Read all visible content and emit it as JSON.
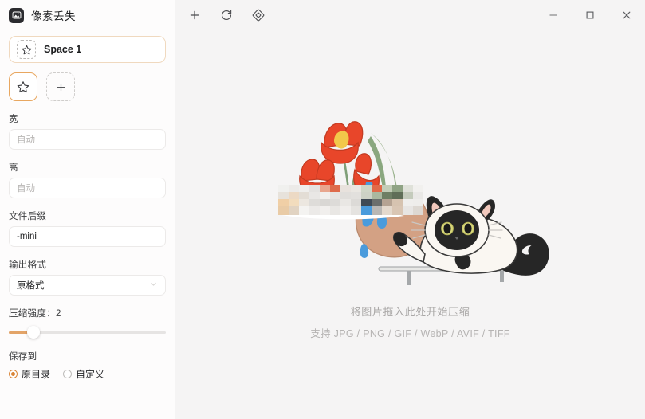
{
  "window": {
    "app_title": "像素丢失",
    "logo_icon": "image-mountain-icon",
    "controls": {
      "minimize_label": "—",
      "maximize_label": "□",
      "close_label": "✕",
      "minimize_icon": "minimize-icon",
      "maximize_icon": "maximize-icon",
      "close_icon": "close-icon"
    }
  },
  "toolbar": {
    "buttons": [
      {
        "name": "add-button",
        "icon": "plus-icon"
      },
      {
        "name": "refresh-button",
        "icon": "refresh-icon"
      },
      {
        "name": "diamond-button",
        "icon": "diamond-icon"
      }
    ]
  },
  "sidebar": {
    "space": {
      "name": "Space 1",
      "thumb_icon": "star-icon"
    },
    "tiles": [
      {
        "name": "space-tile-star",
        "icon": "star-icon",
        "selected": true
      },
      {
        "name": "space-tile-add",
        "icon": "plus-icon",
        "selected": false
      }
    ],
    "fields": {
      "width": {
        "label": "宽",
        "value": "",
        "placeholder": "自动"
      },
      "height": {
        "label": "高",
        "value": "",
        "placeholder": "自动"
      },
      "suffix": {
        "label": "文件后缀",
        "value": "-mini",
        "placeholder": ""
      },
      "format": {
        "label": "输出格式",
        "value": "原格式",
        "chevron_icon": "chevron-down-icon"
      },
      "compression": {
        "label": "压缩强度：2",
        "value": 2,
        "min": 1,
        "max": 10,
        "percent": 15.5
      },
      "save_to": {
        "label": "保存到",
        "options": [
          {
            "label": "原目录",
            "selected": true
          },
          {
            "label": "自定义",
            "selected": false
          }
        ]
      }
    }
  },
  "main": {
    "dropzone": {
      "illustration": "cat-knocking-vase-pixelated-illustration",
      "line1": "将图片拖入此处开始压缩",
      "line2": "支持 JPG / PNG / GIF / WebP / AVIF / TIFF"
    }
  },
  "colors": {
    "accent": "#d98436",
    "accent_border": "#e8a760",
    "sidebar_bg": "#fdfcfc",
    "main_bg": "#f5f4f4",
    "text": "#1f2022",
    "muted_text": "#a9a7a6",
    "tulip_red": "#e8462a",
    "leaf_green": "#7f9f78",
    "vase_tan": "#d4a387",
    "water_blue": "#4a9bdc",
    "cat_cream": "#faf7f2",
    "cat_dark": "#262626"
  }
}
